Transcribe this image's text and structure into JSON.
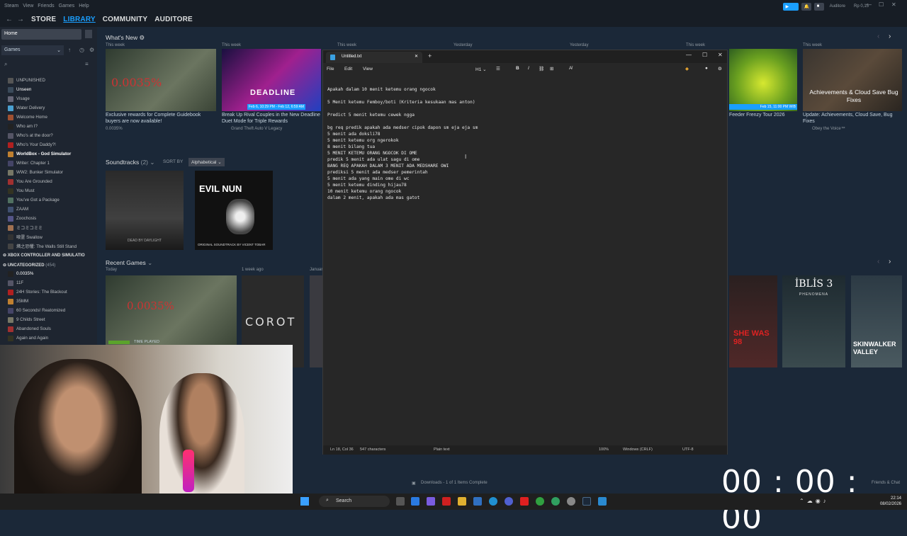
{
  "steam": {
    "titlebar_menu": [
      "Steam",
      "View",
      "Friends",
      "Games",
      "Help"
    ],
    "nav": [
      "STORE",
      "LIBRARY",
      "COMMUNITY",
      "AUDITORE"
    ],
    "user": "Auditore",
    "balance": "Rp 0,15",
    "home": "Home",
    "games_filter": "Games",
    "games": [
      "UNPUNISHED",
      "Unseen",
      "Visage",
      "Water Delivery",
      "Welcome Home",
      "Who am I?",
      "Who's at the door?",
      "Who's Your Daddy?!",
      "WorldBox - God Simulator",
      "Writer: Chapter 1",
      "WW2: Bunker Simulator",
      "You Are Grounded",
      "You Must",
      "You've Got a Package",
      "ZAAM",
      "Zoochosis",
      "ミコミコミミ",
      "喰霊 Swallow",
      "燐之恐懼: The Walls Still Stand"
    ],
    "category_xbox": "XBOX CONTROLLER AND SIMULATIO",
    "category_uncat": "UNCATEGORIZED",
    "uncat_count": "(454)",
    "uncat_games": [
      "0.0035%",
      "11F",
      "24H Stories: The Blackout",
      "35MM",
      "60 Seconds! Reatomized",
      "9 Childs Street",
      "Abandoned Souls",
      "Again and Again"
    ],
    "whats_new": "What's New",
    "week_labels": [
      "This week",
      "This week",
      "This week",
      "Yesterday",
      "This week",
      "This week",
      "This week"
    ],
    "news": [
      {
        "caption": "Exclusive rewards for Complete Guidebook buyers are now available!",
        "sub": "0.0035%"
      },
      {
        "caption": "Break Up Rival Couples in the New Deadline Duet Mode for Triple Rewards",
        "sub": "Grand Theft Auto V Legacy",
        "badge": "Feb 6, 10:29 PM - Feb 12, 6:59 AM"
      },
      {
        "caption": "Feeder Frenzy Tour 2026",
        "badge": "Feb 15, 11:00 PM WIB"
      },
      {
        "caption": "Update: Achievements, Cloud Save, Bug Fixes",
        "sub": "Obey the Voice™",
        "overlay": "Achievements & Cloud Save Bug Fixes"
      }
    ],
    "soundtracks": "Soundtracks",
    "soundtracks_count": "(2)",
    "sort_by": "SORT BY",
    "sort_value": "Alphabetical",
    "soundtrack_tiles": [
      "DEAD BY DAYLIGHT",
      "EVIL NUN",
      "ORIGINAL SOUNDTRACK BY VICENT TOBAR"
    ],
    "recent_games": "Recent Games",
    "recent_labels": [
      "Today",
      "1 week ago",
      "January"
    ],
    "recent_tiles": [
      "0.0035%",
      "COROT",
      "SHE WAS 98",
      "İBLİS 3",
      "PHENOMENA",
      "SKINWALKER VALLEY"
    ],
    "time_played": "TIME PLAYED",
    "downloads": "Downloads - 1 of 1 Items Complete",
    "friends_chat": "Friends & Chat"
  },
  "notepad": {
    "tab_title": "Untitled.txt",
    "menu": [
      "File",
      "Edit",
      "View"
    ],
    "heading_btn": "H1",
    "lines": [
      "Apakah dalam 10 menit ketemu orang ngocok",
      "",
      "5 Menit ketemu Femboy/boti (Kriteria kesukaan mas anton)",
      "",
      "Predict 5 menit ketemu cewek ngga",
      "",
      "bg req predik apakah ada medser cipok dapon sm eja eja sm",
      "5 menit ada doksli78",
      "5 menit ketemu org ngerokok",
      "8 menit bilang tua",
      "5 MENIT KETEMU ORANG NGOCOK DI OME",
      "predik 5 menit ada ulat sagu di ome",
      "BANG REQ APAKAH DALAM 3 MENIT ADA MEDSHARE OWI",
      "prediksi 5 menit ada medser pemerintah",
      "5 menit ada yang main ome di wc",
      "5 menit ketemu dinding hijau78",
      "10 menit ketemu orang ngocok",
      "dalam 2 menit, apakah ada mas gatot"
    ],
    "status_pos": "Ln 18, Col 36",
    "status_chars": "547 characters",
    "status_format": "Plain text",
    "status_zoom": "100%",
    "status_eol": "Windows (CRLF)",
    "status_enc": "UTF-8"
  },
  "timer": "00 : 00 : 00",
  "taskbar": {
    "search": "Search",
    "time": "22:14",
    "date": "08/02/2026"
  },
  "colors": {
    "steam_bg": "#1b2838",
    "accent": "#1a9fff",
    "notepad_bg": "#272727"
  }
}
